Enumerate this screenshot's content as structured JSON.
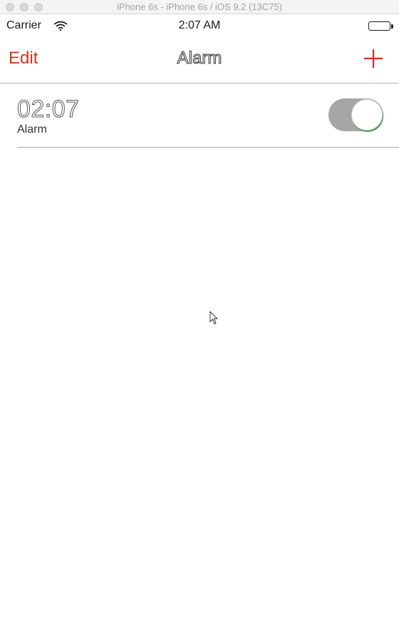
{
  "simulator": {
    "title": "iPhone 6s - iPhone 6s / iOS 9.2 (13C75)"
  },
  "status_bar": {
    "carrier": "Carrier",
    "wifi_icon": "wifi-icon",
    "time": "2:07 AM",
    "battery_icon": "battery-icon"
  },
  "nav": {
    "edit_label": "Edit",
    "title": "Alarm",
    "add_icon": "plus-icon"
  },
  "alarms": [
    {
      "time": "02:07",
      "label": "Alarm",
      "enabled": true
    }
  ],
  "colors": {
    "accent": "#d0331f",
    "toggle_track": "#a6a6a6",
    "toggle_edge": "#4a9a54"
  }
}
